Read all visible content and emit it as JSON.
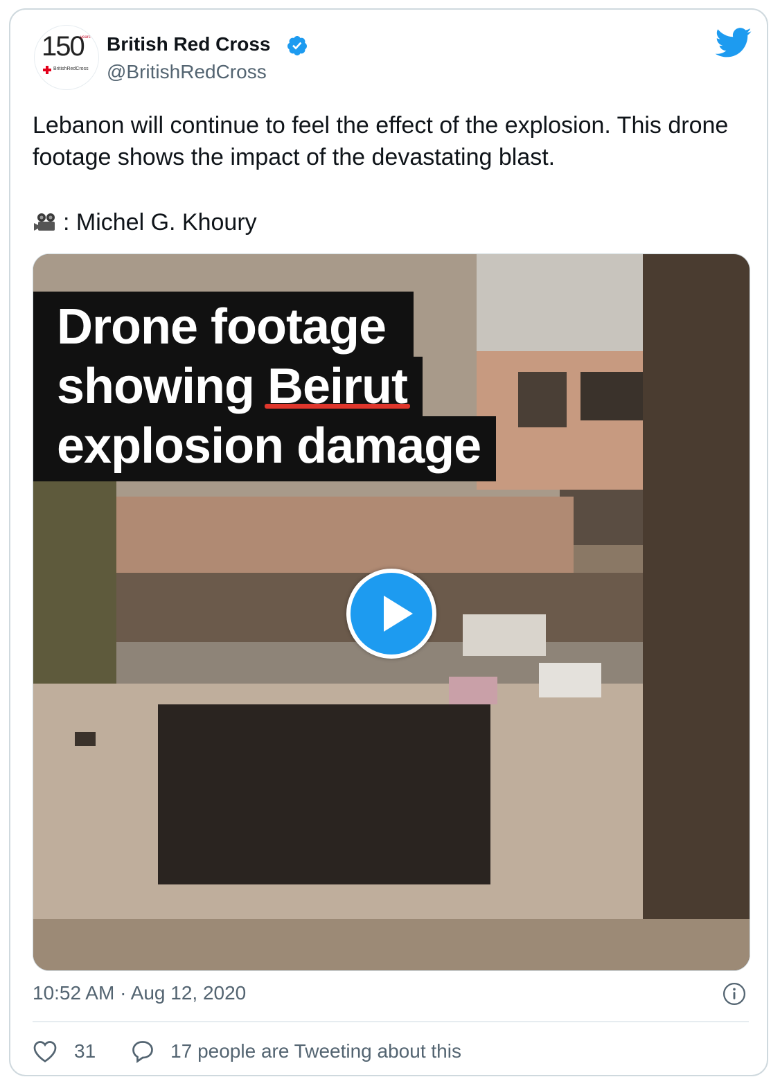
{
  "author": {
    "name": "British Red Cross",
    "handle": "@BritishRedCross",
    "avatar_number": "150",
    "avatar_years_label": "years",
    "avatar_brand": "BritishRedCross",
    "verified_icon": "verified-badge-icon",
    "verified_color": "#1d9bf0"
  },
  "brand_icon": "twitter-bird-icon",
  "tweet": {
    "text": "Lebanon will continue to feel the effect of the explosion. This drone footage shows the impact of the devastating blast.",
    "credit_icon": "movie-camera-icon",
    "credit": ": Michel G. Khoury"
  },
  "media": {
    "overlay_line1": "Drone footage",
    "overlay_line2_pre": "showing ",
    "overlay_line2_highlight": "Beirut",
    "overlay_line3": "explosion damage",
    "highlight_color": "#e0362c",
    "play_button_color": "#1d9bf0"
  },
  "meta": {
    "timestamp": "10:52 AM · Aug 12, 2020",
    "info_icon": "info-icon"
  },
  "actions": {
    "like_count": "31",
    "conversation_text": "17 people are Tweeting about this"
  }
}
